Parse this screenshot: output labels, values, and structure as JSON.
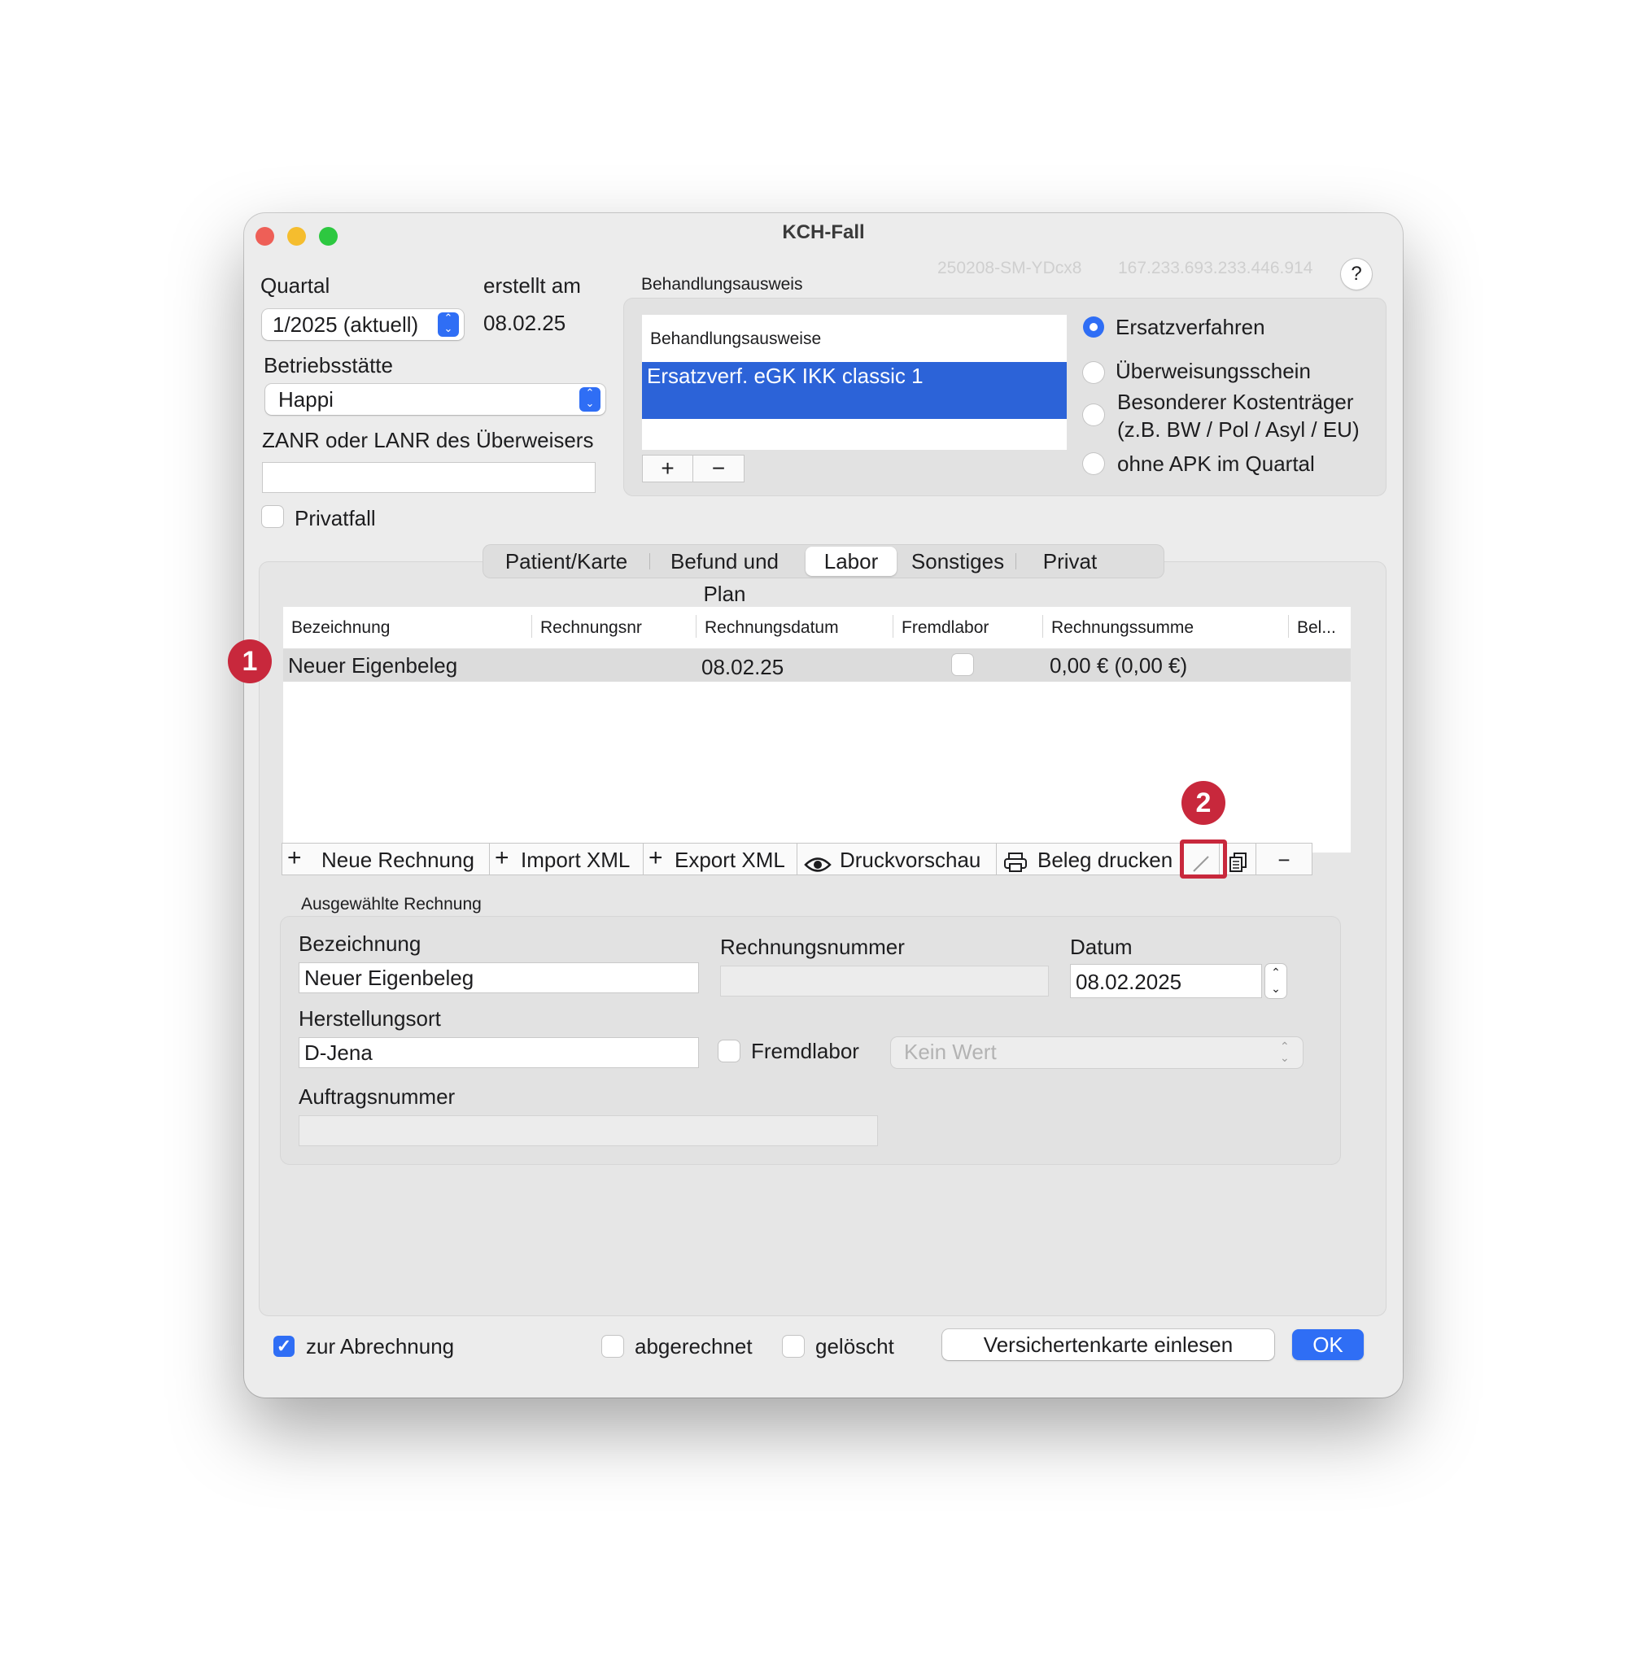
{
  "window": {
    "title": "KCH-Fall",
    "case_id": "250208-SM-YDcx8",
    "case_number": "167.233.693.233.446.914",
    "help_label": "?"
  },
  "top": {
    "quartal_label": "Quartal",
    "quartal_value": "1/2025 (aktuell)",
    "erstellt_label": "erstellt am",
    "erstellt_value": "08.02.25",
    "betriebsstaette_label": "Betriebsstätte",
    "betriebsstaette_value": "Happi",
    "zanr_label": "ZANR oder LANR des Überweisers",
    "zanr_value": "",
    "privatfall_label": "Privatfall",
    "privatfall_checked": false
  },
  "behandlungsausweis": {
    "group_label": "Behandlungsausweis",
    "list_header": "Behandlungsausweise",
    "items": [
      "Ersatzverf. eGK IKK classic 1"
    ],
    "add_label": "+",
    "remove_label": "−",
    "options": [
      {
        "label": "Ersatzverfahren",
        "selected": true
      },
      {
        "label": "Überweisungsschein",
        "selected": false
      },
      {
        "label": "Besonderer Kostenträger",
        "label2": "(z.B. BW / Pol / Asyl / EU)",
        "selected": false
      },
      {
        "label": "ohne APK im Quartal",
        "selected": false
      }
    ]
  },
  "tabs": [
    "Patient/Karte",
    "Befund und Plan",
    "Labor",
    "Sonstiges",
    "Privat"
  ],
  "selected_tab": "Labor",
  "table": {
    "columns": [
      "Bezeichnung",
      "Rechnungsnr",
      "Rechnungsdatum",
      "Fremdlabor",
      "Rechnungssumme",
      "Bel..."
    ],
    "rows": [
      {
        "bezeichnung": "Neuer Eigenbeleg",
        "rechnungsnr": "",
        "rechnungsdatum": "08.02.25",
        "fremdlabor": false,
        "rechnungssumme": "0,00 € (0,00 €)",
        "beleg": ""
      }
    ]
  },
  "toolbar": {
    "neue_rechnung": "Neue Rechnung",
    "import_xml": "Import XML",
    "export_xml": "Export XML",
    "druckvorschau": "Druckvorschau",
    "beleg_drucken": "Beleg drucken",
    "remove": "−"
  },
  "annotations": {
    "badge1": "1",
    "badge2": "2"
  },
  "selected_invoice": {
    "group_label": "Ausgewählte Rechnung",
    "bezeichnung_label": "Bezeichnung",
    "bezeichnung_value": "Neuer Eigenbeleg",
    "rechnungsnummer_label": "Rechnungsnummer",
    "rechnungsnummer_value": "",
    "datum_label": "Datum",
    "datum_value": "08.02.2025",
    "herstellungsort_label": "Herstellungsort",
    "herstellungsort_value": "D-Jena",
    "fremdlabor_label": "Fremdlabor",
    "fremdlabor_select": "Kein Wert",
    "auftragsnummer_label": "Auftragsnummer",
    "auftragsnummer_value": ""
  },
  "footer": {
    "zur_abrechnung": "zur Abrechnung",
    "zur_abrechnung_checked": true,
    "abgerechnet": "abgerechnet",
    "geloescht": "gelöscht",
    "versichertenkarte": "Versichertenkarte einlesen",
    "ok": "OK"
  },
  "colors": {
    "accent": "#2f6ef5",
    "selection": "#2c63d8",
    "badge": "#c8283c",
    "traffic_red": "#ee5f57",
    "traffic_yellow": "#f5bd2e",
    "traffic_green": "#2dc840"
  }
}
